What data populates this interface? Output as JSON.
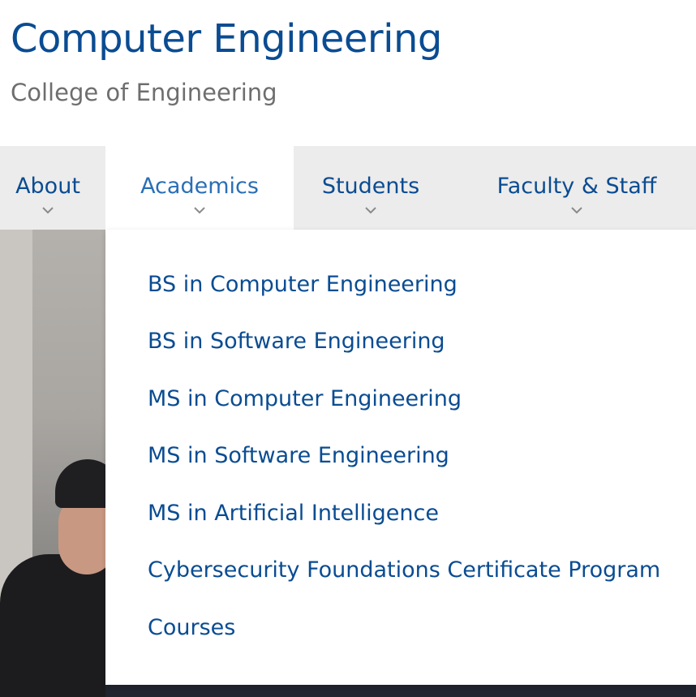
{
  "header": {
    "title": "Computer Engineering",
    "subtitle": "College of Engineering"
  },
  "nav": {
    "items": [
      {
        "label": "About",
        "icon": "chevron-down-icon"
      },
      {
        "label": "Academics",
        "icon": "chevron-down-icon",
        "active": true
      },
      {
        "label": "Students",
        "icon": "chevron-down-icon"
      },
      {
        "label": "Faculty & Staff",
        "icon": "chevron-down-icon"
      }
    ]
  },
  "dropdown": {
    "items": [
      "BS in Computer Engineering",
      "BS in Software Engineering",
      "MS in Computer Engineering",
      "MS in Software Engineering",
      "MS in Artificial Intelligence",
      "Cybersecurity Foundations Certificate Program",
      "Courses"
    ]
  },
  "colors": {
    "brand_blue": "#0a4c92",
    "active_label": "#2a6fb5",
    "nav_bg": "#ececec",
    "subtitle_gray": "#6e6e6e"
  }
}
